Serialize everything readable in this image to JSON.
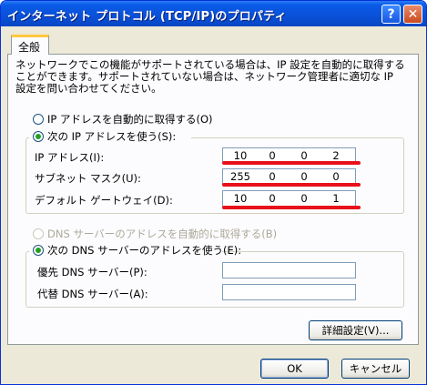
{
  "window": {
    "title": "インターネット プロトコル (TCP/IP)のプロパティ",
    "help_label": "?",
    "close_label": "✕"
  },
  "tabs": [
    {
      "label": "全般"
    }
  ],
  "description": "ネットワークでこの機能がサポートされている場合は、IP 設定を自動的に取得することができます。サポートされていない場合は、ネットワーク管理者に適切な IP 設定を問い合わせてください。",
  "ip_section": {
    "auto_option": "IP アドレスを自動的に取得する(O)",
    "manual_option": "次の IP アドレスを使う(S):",
    "selected": "manual",
    "fields": [
      {
        "label": "IP アドレス(I):",
        "value": [
          "10",
          "0",
          "0",
          "2"
        ]
      },
      {
        "label": "サブネット マスク(U):",
        "value": [
          "255",
          "0",
          "0",
          "0"
        ]
      },
      {
        "label": "デフォルト ゲートウェイ(D):",
        "value": [
          "10",
          "0",
          "0",
          "1"
        ]
      }
    ]
  },
  "dns_section": {
    "auto_option": "DNS サーバーのアドレスを自動的に取得する(B)",
    "manual_option": "次の DNS サーバーのアドレスを使う(E):",
    "selected": "manual",
    "auto_disabled": true,
    "fields": [
      {
        "label": "優先 DNS サーバー(P):",
        "value": ""
      },
      {
        "label": "代替 DNS サーバー(A):",
        "value": ""
      }
    ]
  },
  "buttons": {
    "advanced": "詳細設定(V)...",
    "ok": "OK",
    "cancel": "キャンセル"
  },
  "colors": {
    "titlebar": "#0a50d8",
    "window_bg": "#ece9d8",
    "annotation_red": "#e8101a",
    "radio_check": "#21a121"
  }
}
